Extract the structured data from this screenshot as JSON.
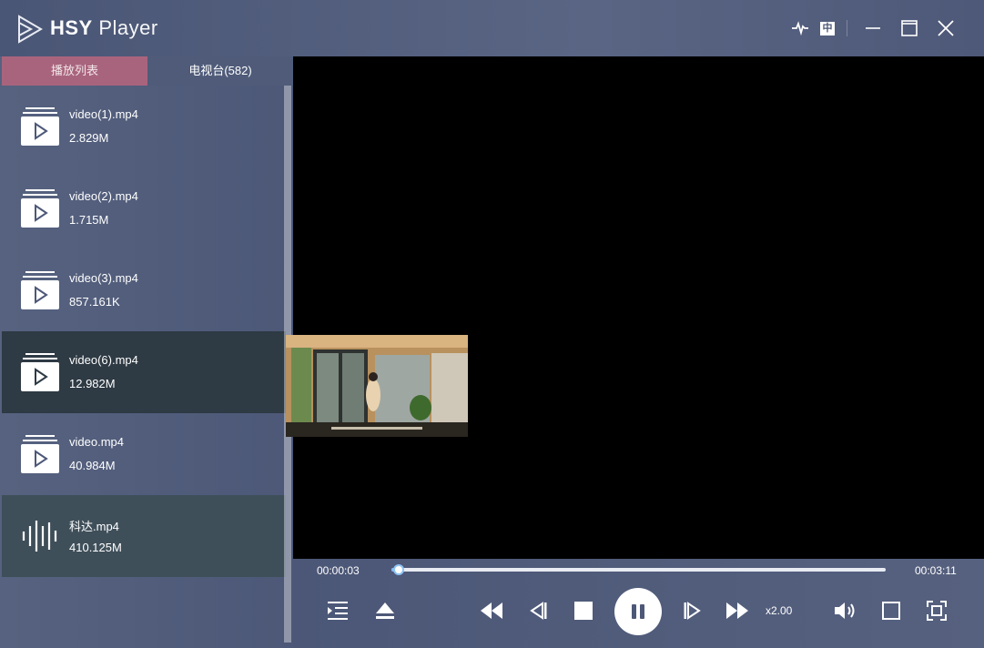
{
  "app": {
    "title_bold": "HSY",
    "title_rest": " Player"
  },
  "titlebar": {
    "icons": [
      "waveform-icon",
      "chinese-language-icon",
      "minimize-icon",
      "maximize-icon",
      "close-icon"
    ],
    "lang_label": "中"
  },
  "sidebar": {
    "tabs": [
      {
        "label": "播放列表",
        "active": true
      },
      {
        "label": "电视台(582)",
        "active": false
      }
    ],
    "items": [
      {
        "name": "video(1).mp4",
        "size": "2.829M",
        "icon": "video-file-icon"
      },
      {
        "name": "video(2).mp4",
        "size": "1.715M",
        "icon": "video-file-icon"
      },
      {
        "name": "video(3).mp4",
        "size": "857.161K",
        "icon": "video-file-icon"
      },
      {
        "name": "video(6).mp4",
        "size": "12.982M",
        "icon": "video-file-icon"
      },
      {
        "name": "video.mp4",
        "size": "40.984M",
        "icon": "video-file-icon"
      },
      {
        "name": "科达.mp4",
        "size": "410.125M",
        "icon": "audio-wave-icon"
      }
    ]
  },
  "player": {
    "current_time": "00:00:03",
    "total_time": "00:03:11",
    "progress": 0.015,
    "speed": "x2.00"
  },
  "colors": {
    "accent_tab": "#a9647d",
    "progress": "#7fb8f0"
  }
}
